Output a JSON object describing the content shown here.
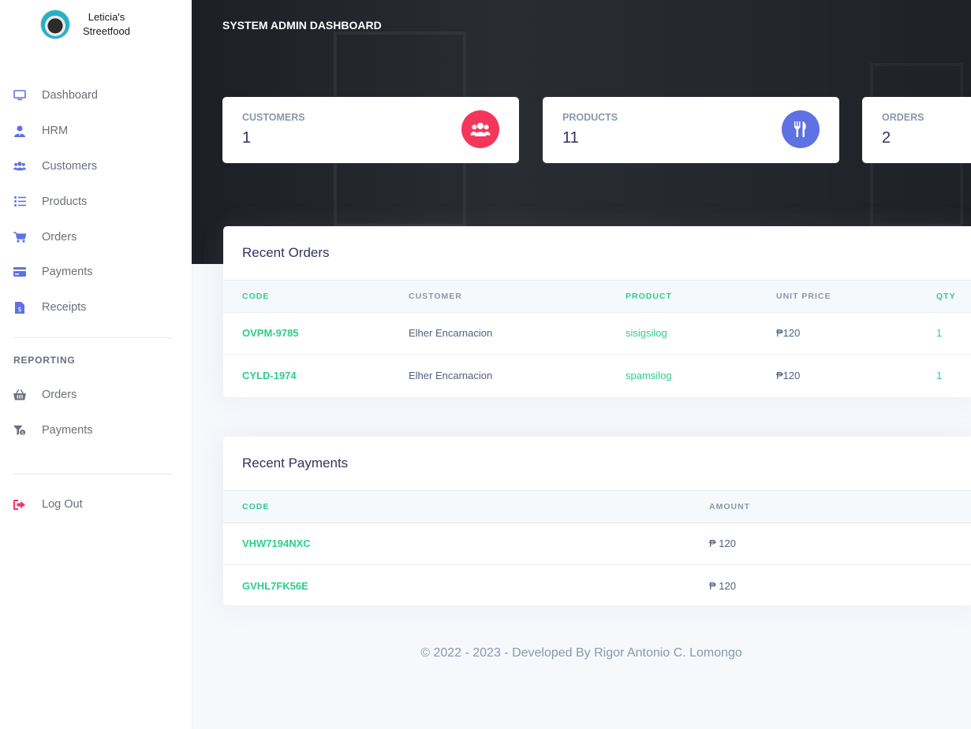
{
  "brand": {
    "name": "Leticia's Streetfood"
  },
  "sidebar": {
    "items": [
      {
        "label": "Dashboard",
        "icon": "monitor-icon"
      },
      {
        "label": "HRM",
        "icon": "user-tie-icon"
      },
      {
        "label": "Customers",
        "icon": "users-icon"
      },
      {
        "label": "Products",
        "icon": "list-icon"
      },
      {
        "label": "Orders",
        "icon": "cart-icon"
      },
      {
        "label": "Payments",
        "icon": "credit-card-icon"
      },
      {
        "label": "Receipts",
        "icon": "receipt-icon"
      }
    ],
    "reporting_title": "REPORTING",
    "reporting_items": [
      {
        "label": "Orders",
        "icon": "basket-icon"
      },
      {
        "label": "Payments",
        "icon": "funnel-dollar-icon"
      }
    ],
    "logout": {
      "label": "Log Out",
      "icon": "sign-out-icon"
    }
  },
  "header": {
    "title": "SYSTEM ADMIN DASHBOARD"
  },
  "stats": [
    {
      "label": "CUSTOMERS",
      "value": "1",
      "icon": "users-icon",
      "color": "#f5365c"
    },
    {
      "label": "PRODUCTS",
      "value": "11",
      "icon": "utensils-icon",
      "color": "#5e72e4"
    },
    {
      "label": "ORDERS",
      "value": "2",
      "icon": "cart-icon",
      "color": "#fb6340"
    }
  ],
  "recent_orders": {
    "title": "Recent Orders",
    "columns": [
      "CODE",
      "CUSTOMER",
      "PRODUCT",
      "UNIT PRICE",
      "QTY"
    ],
    "rows": [
      {
        "code": "OVPM-9785",
        "customer": "Elher Encarnacion",
        "product": "sisigsilog",
        "price": "₱120",
        "qty": "1"
      },
      {
        "code": "CYLD-1974",
        "customer": "Elher Encarnacion",
        "product": "spamsilog",
        "price": "₱120",
        "qty": "1"
      }
    ]
  },
  "recent_payments": {
    "title": "Recent Payments",
    "columns": [
      "CODE",
      "AMOUNT"
    ],
    "rows": [
      {
        "code": "VHW7194NXC",
        "amount": "₱ 120"
      },
      {
        "code": "GVHL7FK56E",
        "amount": "₱ 120"
      }
    ]
  },
  "footer": {
    "text": "© 2022 - 2023 - Developed By Rigor Antonio C. Lomongo"
  },
  "colors": {
    "accent_blue": "#5e72e4",
    "success_green": "#2dce89",
    "danger_red": "#f5365c"
  }
}
